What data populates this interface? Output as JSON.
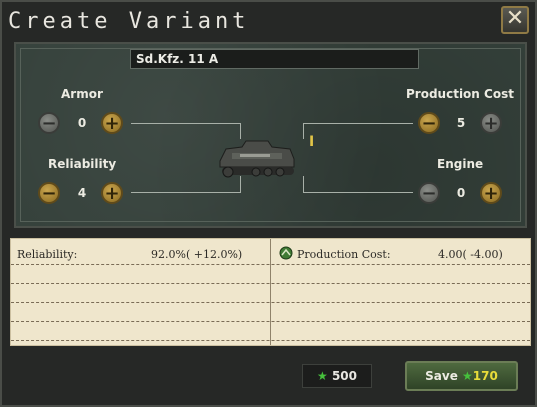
{
  "window": {
    "title": "Create Variant",
    "close_glyph": "✕"
  },
  "variant_name": "Sd.Kfz. 11 A",
  "stats": {
    "armor": {
      "label": "Armor",
      "value": "0"
    },
    "production_cost": {
      "label": "Production Cost",
      "value": "5"
    },
    "reliability": {
      "label": "Reliability",
      "value": "4"
    },
    "engine": {
      "label": "Engine",
      "value": "0"
    }
  },
  "buttons": {
    "minus": "−",
    "plus": "+"
  },
  "cursor_glyph": "I",
  "summary": {
    "reliability_label": "Reliability:",
    "reliability_value": "92.0%( +12.0%)",
    "production_cost_label": "Production Cost:",
    "production_cost_value": "4.00( -4.00)"
  },
  "experience": {
    "icon": "star-icon",
    "value": "500"
  },
  "save": {
    "label": "Save",
    "cost": "170",
    "icon": "star-icon"
  },
  "colors": {
    "accent_gold": "#c9a44c",
    "xp_green": "#46c03c",
    "save_cost_yellow": "#e8dc3a"
  }
}
